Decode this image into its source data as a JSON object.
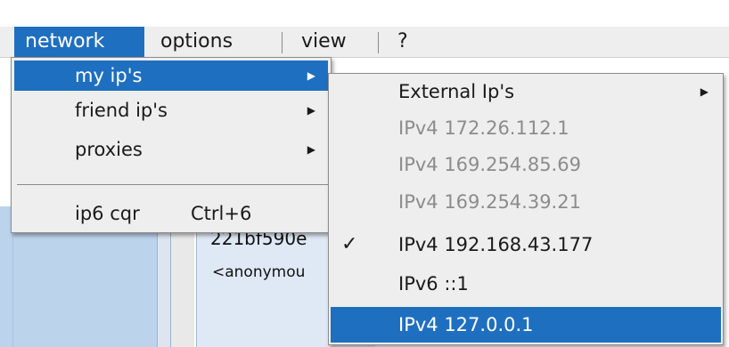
{
  "menubar": {
    "items": [
      {
        "label": "network",
        "active": true
      },
      {
        "label": "options",
        "active": false
      },
      {
        "label": "view",
        "active": false
      },
      {
        "label": "?",
        "active": false
      }
    ]
  },
  "network_menu": {
    "items": [
      {
        "label": "my ip's",
        "has_submenu": true,
        "highlighted": true
      },
      {
        "label": "friend ip's",
        "has_submenu": true,
        "highlighted": false
      },
      {
        "label": "proxies",
        "has_submenu": true,
        "highlighted": false
      },
      {
        "label": "ip6 cqr",
        "shortcut": "Ctrl+6",
        "has_submenu": false,
        "highlighted": false
      }
    ]
  },
  "my_ips_submenu": {
    "items": [
      {
        "label": "External Ip's",
        "has_submenu": true,
        "enabled": true,
        "checked": false
      },
      {
        "label": "IPv4 172.26.112.1",
        "enabled": false,
        "checked": false
      },
      {
        "label": "IPv4 169.254.85.69",
        "enabled": false,
        "checked": false
      },
      {
        "label": "IPv4 169.254.39.21",
        "enabled": false,
        "checked": false
      },
      {
        "label": "IPv4 192.168.43.177",
        "enabled": true,
        "checked": true
      },
      {
        "label": "IPv6 ::1",
        "enabled": true,
        "checked": false
      },
      {
        "label": "IPv4 127.0.0.1",
        "enabled": true,
        "checked": false,
        "highlighted": true
      }
    ]
  },
  "background": {
    "hash_text": "221bf590e",
    "anon_text": "<anonymou"
  },
  "icons": {
    "submenu_arrow": "triangle-right-icon",
    "checkmark": "check-icon"
  },
  "colors": {
    "highlight": "#1f6fc0",
    "menu_bg": "#eeeeee",
    "disabled_text": "#8c8c8c"
  }
}
